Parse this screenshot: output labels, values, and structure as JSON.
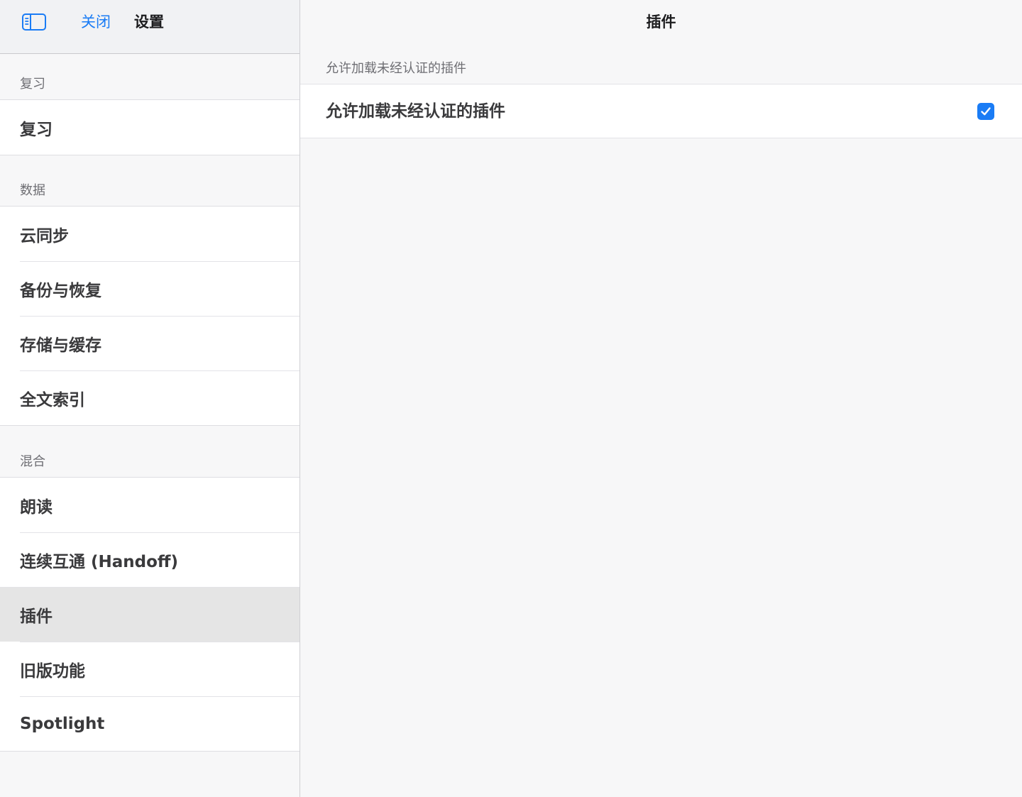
{
  "sidebar": {
    "close_label": "关闭",
    "title": "设置",
    "toggle_icon": "sidebar-toggle-icon",
    "sections": [
      {
        "label": "复习",
        "items": [
          "复习"
        ]
      },
      {
        "label": "数据",
        "items": [
          "云同步",
          "备份与恢复",
          "存储与缓存",
          "全文索引"
        ]
      },
      {
        "label": "混合",
        "items": [
          "朗读",
          "连续互通 (Handoff)",
          "插件",
          "旧版功能",
          "Spotlight"
        ]
      }
    ],
    "selected_item": "插件"
  },
  "main": {
    "title": "插件",
    "section_label": "允许加载未经认证的插件",
    "setting_label": "允许加载未经认证的插件",
    "setting_checked": true
  },
  "colors": {
    "accent": "#1a7cf5",
    "background": "#f7f7f8",
    "selected_row": "#e5e5e5"
  }
}
